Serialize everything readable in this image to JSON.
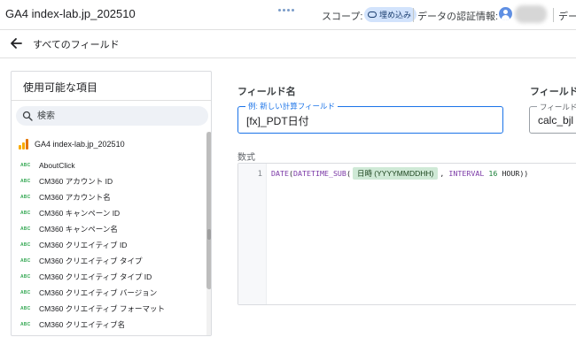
{
  "header": {
    "app_title": "GA4 index-lab.jp_202510",
    "scope_label": "スコープ:",
    "scope_chip": "埋め込み",
    "credentials_label": "データの認証情報:",
    "data_label_truncated": "デー"
  },
  "subheader": {
    "title": "すべてのフィールド"
  },
  "fields_panel": {
    "title": "使用可能な項目",
    "search_placeholder": "検索",
    "source": {
      "label": "GA4 index-lab.jp_202510",
      "icon": "bar-chart-icon"
    },
    "type_icon_text": "ABC",
    "items": [
      "AboutClick",
      "CM360 アカウント ID",
      "CM360 アカウント名",
      "CM360 キャンペーン ID",
      "CM360 キャンペーン名",
      "CM360 クリエイティブ ID",
      "CM360 クリエイティブ タイプ",
      "CM360 クリエイティブ タイプ ID",
      "CM360 クリエイティブ バージョン",
      "CM360 クリエイティブ フォーマット",
      "CM360 クリエイティブ名"
    ]
  },
  "editor": {
    "field_name_label": "フィールド名",
    "field_name_float_label": "例: 新しい計算フィールド",
    "field_name_value": "[fx]_PDT日付",
    "field_id_label": "フィールド",
    "field_id_float_label": "フィールド I",
    "field_id_value": "calc_bjl",
    "formula_label": "数式",
    "line_number": "1",
    "code": {
      "fn_date": "DATE",
      "paren_open_1": "(",
      "fn_datetime_sub": "DATETIME_SUB",
      "paren_open_2": "(",
      "field_chip": "日時 (YYYYMMDDHH)",
      "comma": ",",
      "kw_interval": "INTERVAL",
      "num": "16",
      "unit": "HOUR",
      "paren_close": "))"
    }
  },
  "colors": {
    "accent": "#1a73e8",
    "chip_bg": "#d2e3fc",
    "field_chip_bg": "#cfe9d6",
    "abc_icon": "#34a853",
    "keyword": "#7c3aa7"
  }
}
